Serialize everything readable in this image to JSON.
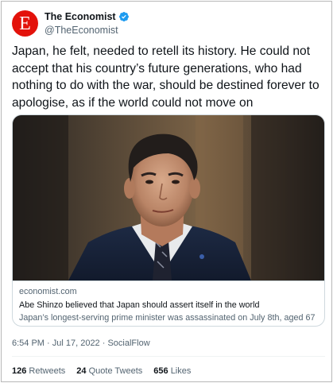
{
  "author": {
    "display_name": "The Economist",
    "handle": "@TheEconomist",
    "avatar_letter": "E",
    "avatar_color": "#e3120b",
    "verified": true
  },
  "tweet": {
    "text": "Japan, he felt, needed to retell its history. He could not accept that his country’s future generations, who had nothing to do with the war, should be destined forever to apologise, as if the world could not move on"
  },
  "card": {
    "image_icon": "photo-of-shinzo-abe",
    "domain": "economist.com",
    "title": "Abe Shinzo believed that Japan should assert itself in the world",
    "description": "Japan’s longest-serving prime minister was assassinated on July 8th, aged 67"
  },
  "meta": {
    "timestamp": "6:54 PM · Jul 17, 2022",
    "source": "SocialFlow"
  },
  "stats": {
    "retweets_count": "126",
    "retweets_label": "Retweets",
    "quotes_count": "24",
    "quotes_label": "Quote Tweets",
    "likes_count": "656",
    "likes_label": "Likes"
  },
  "colors": {
    "verified_badge": "#1d9bf0",
    "secondary_text": "#536471"
  }
}
